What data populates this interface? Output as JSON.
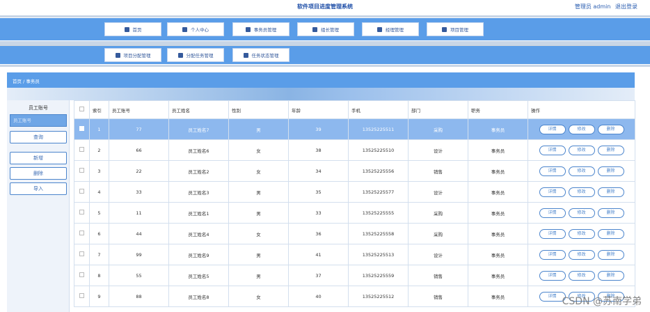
{
  "app": {
    "title": "软件项目进度管理系统",
    "user": "管理员 admin",
    "logout": "退出登录"
  },
  "nav_row1": [
    {
      "label": "首页",
      "icon": "home-icon"
    },
    {
      "label": "个人中心",
      "icon": "user-icon"
    },
    {
      "label": "事务员管理",
      "icon": "card-icon"
    },
    {
      "label": "组长管理",
      "icon": "grid-icon"
    },
    {
      "label": "经理管理",
      "icon": "grid-icon"
    },
    {
      "label": "项目管理",
      "icon": "briefcase-icon"
    }
  ],
  "nav_row2": [
    {
      "label": "项目分配管理",
      "icon": "check-icon"
    },
    {
      "label": "分配任务管理",
      "icon": "grid-icon"
    },
    {
      "label": "任务状态管理",
      "icon": "doc-icon"
    }
  ],
  "breadcrumb": "首页 / 事务员",
  "search": {
    "label": "员工账号",
    "placeholder": "员工账号",
    "query": "查询",
    "add": "新增",
    "delete": "删除",
    "import": "导入"
  },
  "table": {
    "headers": [
      "",
      "索引",
      "员工账号",
      "员工姓名",
      "性别",
      "年龄",
      "手机",
      "部门",
      "职务",
      "操作"
    ],
    "actions": [
      "详情",
      "修改",
      "删除"
    ],
    "rows": [
      [
        "1",
        "77",
        "员工姓名7",
        "男",
        "39",
        "13525225511",
        "采购",
        "事务员"
      ],
      [
        "2",
        "66",
        "员工姓名6",
        "女",
        "38",
        "13525225510",
        "设计",
        "事务员"
      ],
      [
        "3",
        "22",
        "员工姓名2",
        "女",
        "34",
        "13525225556",
        "销售",
        "事务员"
      ],
      [
        "4",
        "33",
        "员工姓名3",
        "男",
        "35",
        "13525225577",
        "设计",
        "事务员"
      ],
      [
        "5",
        "11",
        "员工姓名1",
        "男",
        "33",
        "13525225555",
        "采购",
        "事务员"
      ],
      [
        "6",
        "44",
        "员工姓名4",
        "女",
        "36",
        "13525225558",
        "采购",
        "事务员"
      ],
      [
        "7",
        "99",
        "员工姓名9",
        "男",
        "41",
        "13525225513",
        "设计",
        "事务员"
      ],
      [
        "8",
        "55",
        "员工姓名5",
        "男",
        "37",
        "13525225559",
        "销售",
        "事务员"
      ],
      [
        "9",
        "88",
        "员工姓名8",
        "女",
        "40",
        "13525225512",
        "销售",
        "事务员"
      ]
    ]
  },
  "watermark": "CSDN @苏南学弟"
}
